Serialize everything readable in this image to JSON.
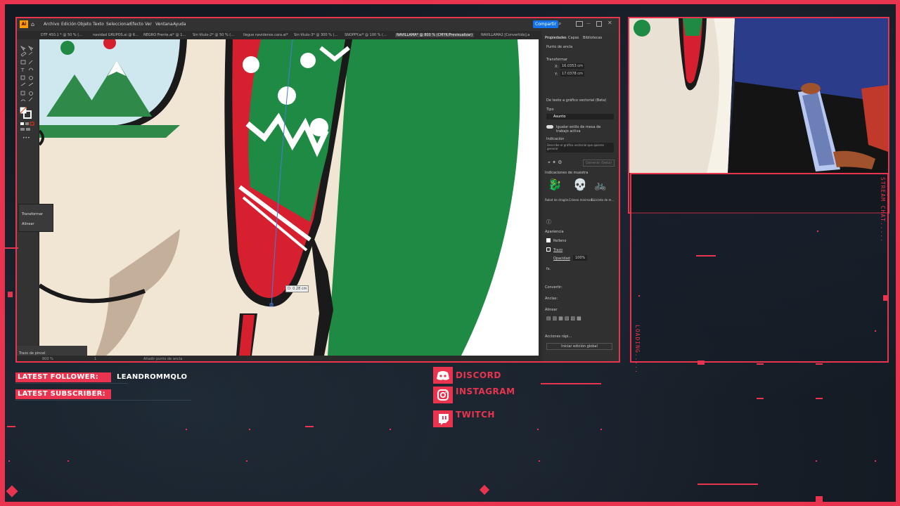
{
  "overlay": {
    "accent_color": "#e8344f",
    "latest_follower_label": "LATEST FOLLOWER:",
    "latest_follower_value": "LEANDROMMQLO",
    "latest_subscriber_label": "LATEST SUBSCRIBER:",
    "latest_subscriber_value": "",
    "stream_chat_label": "STREAM CHAT.....",
    "loading_label": "LOADING.....",
    "socials": [
      {
        "name": "DISCORD",
        "icon": "discord-icon"
      },
      {
        "name": "INSTAGRAM",
        "icon": "instagram-icon"
      },
      {
        "name": "TWITCH",
        "icon": "twitch-icon"
      }
    ]
  },
  "illustrator": {
    "app_logo": "Ai",
    "menu": [
      "Archivo",
      "Edición",
      "Objeto",
      "Texto",
      "Seleccionar",
      "Efecto",
      "Ver",
      "Ventana",
      "Ayuda"
    ],
    "share_button": "Compartir",
    "tabs": [
      "DTF 450.1 * @ 50 % (...",
      "navidad GRUPOS.ai @ 6...",
      "NEGRO Frente.ai* @ 1...",
      "Sin título-2* @ 50 % (...",
      "llegue navidenos.cara.ai*",
      "Sin título-3* @ 300 % (...",
      "SNOPPY.ai* @ 100 % (...",
      "NAVILLAMA* @ 800 % (CMYK/Previsualizar)",
      "NAVILLAMA2 [Convertido].a"
    ],
    "canvas_tooltip": "D: 0.28 cm",
    "floating_panel": {
      "items": [
        "Transformar",
        "Alinear"
      ]
    },
    "bottom_left_panel": "Trazo de pincel",
    "statusbar": {
      "zoom": "800 %",
      "page": "1",
      "tool": "Añadir punto de ancla"
    },
    "properties": {
      "tabs": [
        "Propiedades",
        "Capas",
        "Bibliotecas"
      ],
      "section_anchor": "Punto de ancla",
      "transform_label": "Transformar",
      "x_label": "X:",
      "x_value": "16.0353 cm",
      "y_label": "Y:",
      "y_value": "17.0378 cm",
      "generative_section": "De texto a gráfico vectorial (Beta)",
      "type_label": "Tipo",
      "type_value": "Asunto",
      "toggle_label": "Igualar estilo de mesa de trabajo activa",
      "prompt_label": "Indicación",
      "prompt_placeholder": "Describe el gráfico vectorial que quieres generar",
      "generate_button": "Generar (beta)",
      "samples_label": "Indicaciones de muestra",
      "samples": [
        "Robot de dragón...",
        "Cráneo minimali...",
        "Bicicleta de m..."
      ],
      "appearance_label": "Apariencia",
      "fill_label": "Relleno",
      "stroke_label": "Trazo",
      "opacity_label": "Opacidad",
      "opacity_value": "100%",
      "fx_label": "fx.",
      "convert_label": "Convertir:",
      "anchors_label": "Anclas:",
      "align_label": "Alinear",
      "quick_actions_label": "Acciones rápi...",
      "quick_action_button": "Iniciar edición global"
    }
  }
}
